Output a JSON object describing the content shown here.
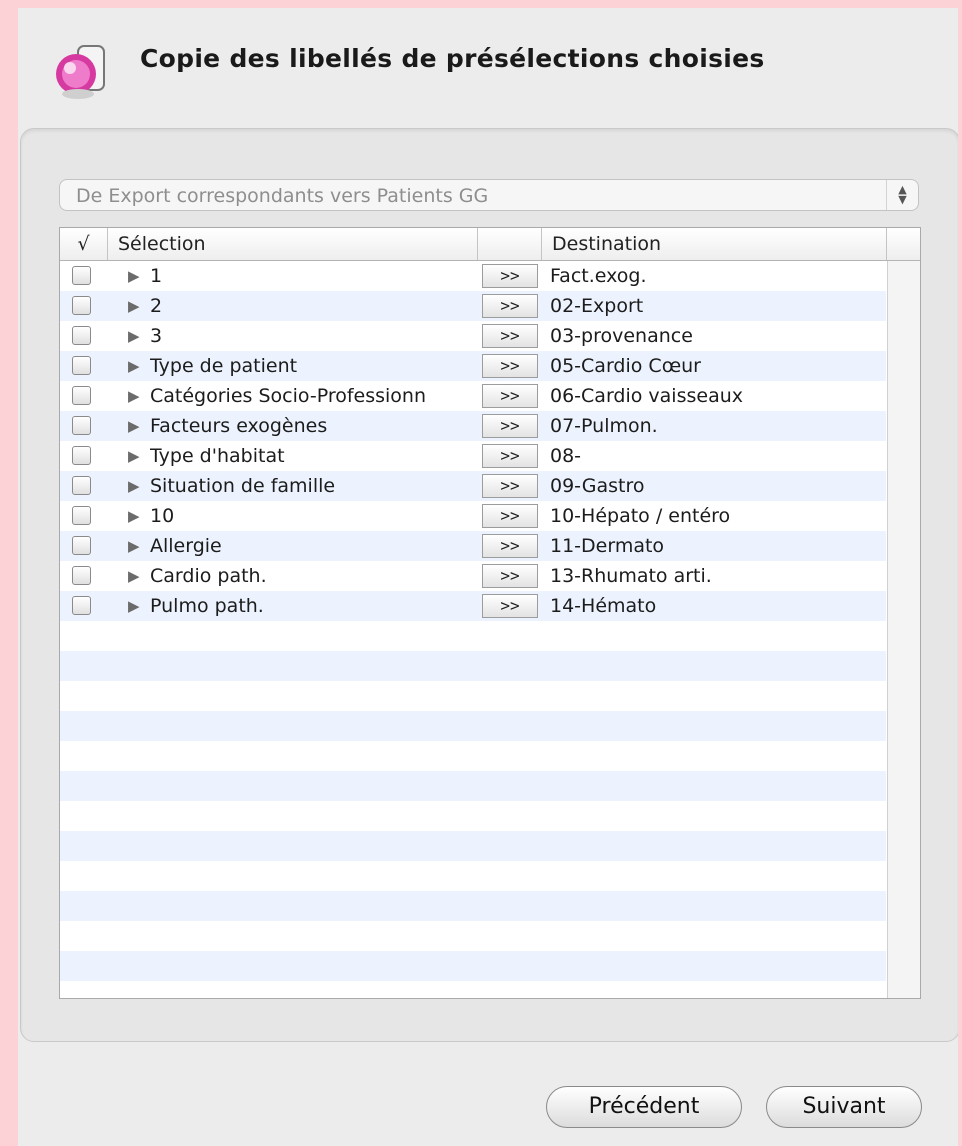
{
  "window": {
    "title": "Copie des libellés de présélections choisies",
    "app_icon": "pink-ball-scroll-icon"
  },
  "popup": {
    "value": "De Export correspondants vers Patients GG",
    "arrows": "⌃⌄"
  },
  "table": {
    "columns": {
      "check": "√",
      "selection": "Sélection",
      "destination": "Destination"
    },
    "copy_button_label": ">>",
    "rows": [
      {
        "selection": "1",
        "destination": "Fact.exog."
      },
      {
        "selection": "2",
        "destination": "02-Export"
      },
      {
        "selection": "3",
        "destination": "03-provenance"
      },
      {
        "selection": "Type de patient",
        "destination": "05-Cardio Cœur"
      },
      {
        "selection": "Catégories Socio-Professionn",
        "destination": "06-Cardio vaisseaux"
      },
      {
        "selection": "Facteurs exogènes",
        "destination": "07-Pulmon."
      },
      {
        "selection": "Type d'habitat",
        "destination": "08-"
      },
      {
        "selection": "Situation de famille",
        "destination": "09-Gastro"
      },
      {
        "selection": "10",
        "destination": "10-Hépato / entéro"
      },
      {
        "selection": "Allergie",
        "destination": "11-Dermato"
      },
      {
        "selection": "Cardio path.",
        "destination": "13-Rhumato arti."
      },
      {
        "selection": "Pulmo path.",
        "destination": "14-Hémato"
      }
    ],
    "disclosure_glyph": "▶"
  },
  "footer": {
    "previous_label": "Précédent",
    "next_label": "Suivant"
  }
}
